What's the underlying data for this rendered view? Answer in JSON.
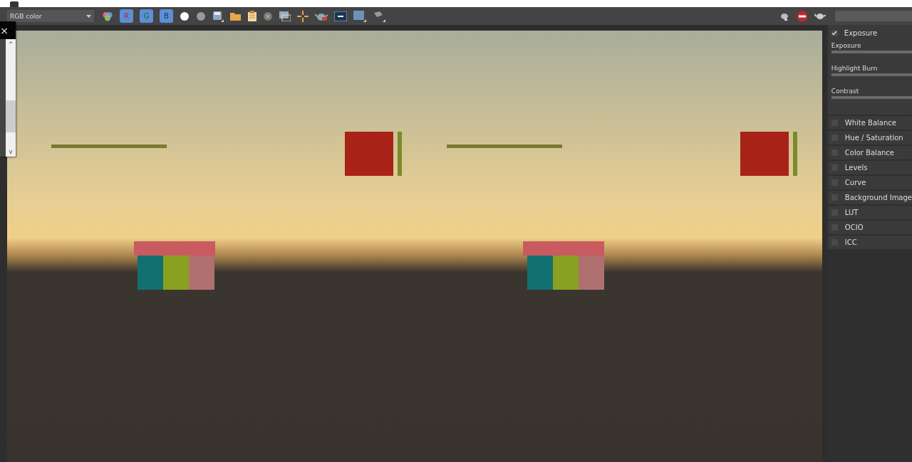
{
  "toolbar": {
    "channel_select": {
      "value": "RGB color"
    },
    "channels": [
      {
        "label": "R",
        "selected": true
      },
      {
        "label": "G",
        "selected": true
      },
      {
        "label": "B",
        "selected": true
      }
    ]
  },
  "popup": {
    "close": "×",
    "scroll_up": "^",
    "scroll_down": "v"
  },
  "panel": {
    "sections": [
      {
        "label": "Exposure",
        "checked": true,
        "kind": "group",
        "sliders": [
          {
            "label": "Exposure"
          },
          {
            "label": "Highlight Burn"
          },
          {
            "label": "Contrast"
          }
        ]
      },
      {
        "label": "White Balance",
        "checked": false,
        "kind": "row"
      },
      {
        "label": "Hue / Saturation",
        "checked": false,
        "kind": "row"
      },
      {
        "label": "Color Balance",
        "checked": false,
        "kind": "row"
      },
      {
        "label": "Levels",
        "checked": false,
        "kind": "row"
      },
      {
        "label": "Curve",
        "checked": false,
        "kind": "row"
      },
      {
        "label": "Background Image",
        "checked": false,
        "kind": "row"
      },
      {
        "label": "LUT",
        "checked": false,
        "kind": "row"
      },
      {
        "label": "OCIO",
        "checked": false,
        "kind": "row"
      },
      {
        "label": "ICC",
        "checked": false,
        "kind": "row"
      }
    ]
  }
}
